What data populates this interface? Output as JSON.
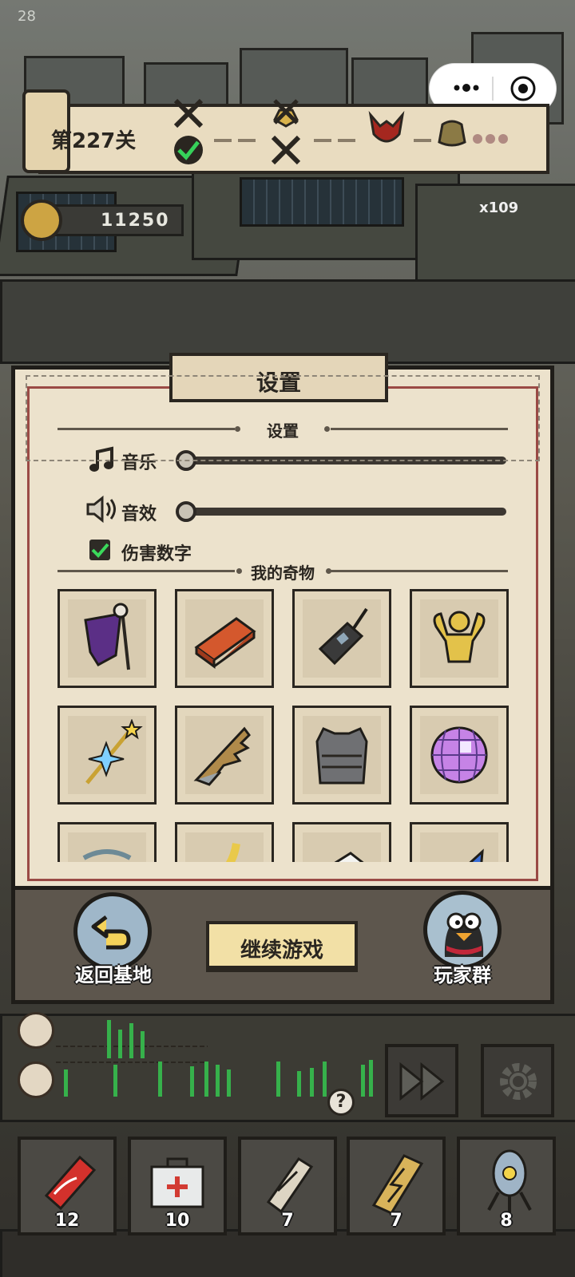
{
  "fps": "28",
  "level": {
    "label": "第227关"
  },
  "coins": "11250",
  "enemy_counter": "x109",
  "settings": {
    "title": "设置",
    "section_label": "设置",
    "music_label": "音乐",
    "music_level": 0,
    "sfx_label": "音效",
    "sfx_level": 0,
    "damage_numbers_label": "伤害数字",
    "damage_numbers_checked": true
  },
  "relics": {
    "section_label": "我的奇物",
    "items": [
      {
        "icon": "purple-banner-icon"
      },
      {
        "icon": "red-brick-icon"
      },
      {
        "icon": "walkie-talkie-icon"
      },
      {
        "icon": "golden-muscle-statue-icon"
      },
      {
        "icon": "star-wand-icon"
      },
      {
        "icon": "jagged-blade-icon"
      },
      {
        "icon": "body-armor-icon"
      },
      {
        "icon": "disco-ball-icon"
      },
      {
        "icon": "partial-item-icon"
      },
      {
        "icon": "partial-item-icon"
      },
      {
        "icon": "partial-item-icon"
      },
      {
        "icon": "partial-item-icon"
      }
    ]
  },
  "footer": {
    "back_label": "返回基地",
    "continue_label": "继续游戏",
    "group_label": "玩家群"
  },
  "hud": {
    "help_symbol": "?",
    "items": [
      {
        "icon": "cola-can-icon",
        "count": "12"
      },
      {
        "icon": "first-aid-kit-icon",
        "count": "10"
      },
      {
        "icon": "scroll-icon",
        "count": "7"
      },
      {
        "icon": "lightning-scroll-icon",
        "count": "7"
      },
      {
        "icon": "nuke-bomb-icon",
        "count": "8"
      }
    ]
  },
  "colors": {
    "paper": "#ece2cc",
    "ink": "#2a2620",
    "accent_red": "#9a4a45",
    "wave_green": "#36b14b",
    "button_yellow": "#f2e0a6"
  }
}
